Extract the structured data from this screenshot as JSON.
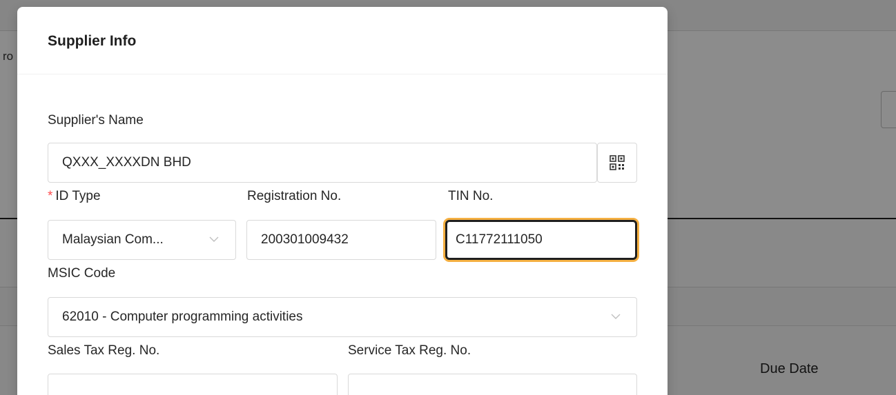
{
  "background": {
    "fragment_text": "ro",
    "due_date_label": "Due Date"
  },
  "modal": {
    "title": "Supplier Info",
    "supplier_name": {
      "label": "Supplier's Name",
      "value": "QXXX_XXXXDN BHD"
    },
    "qr_button_icon": "qr-code-icon",
    "id_type": {
      "required_mark": "*",
      "label": "ID Type",
      "value": "Malaysian Com..."
    },
    "registration_no": {
      "label": "Registration No.",
      "value": "200301009432"
    },
    "tin_no": {
      "label": "TIN No.",
      "value": "C11772111050"
    },
    "msic_code": {
      "label": "MSIC Code",
      "value": "62010 - Computer programming activities"
    },
    "sales_tax": {
      "label": "Sales Tax Reg. No.",
      "value": ""
    },
    "service_tax": {
      "label": "Service Tax Reg. No.",
      "value": ""
    }
  },
  "colors": {
    "required": "#ff4d4f",
    "focus_ring": "#f5b042",
    "border": "#d9d9d9"
  }
}
